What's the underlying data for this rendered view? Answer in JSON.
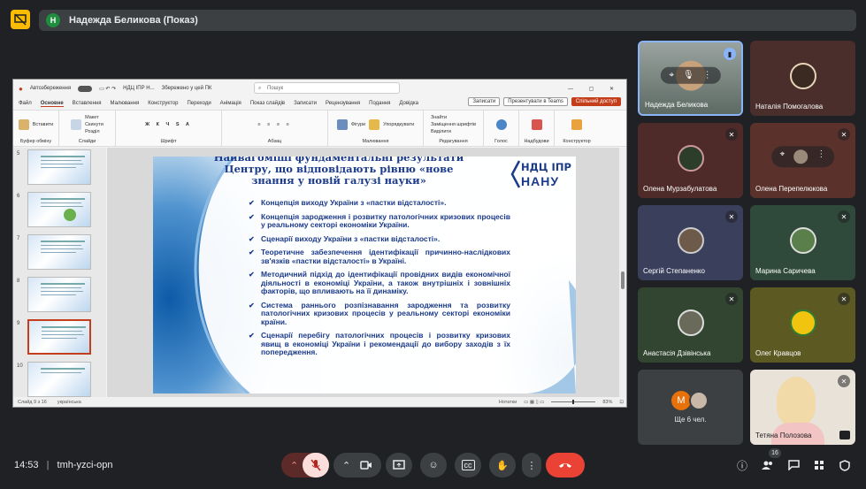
{
  "meeting": {
    "presenter_initial": "Н",
    "presenter_label": "Надежда Беликова (Показ)",
    "time": "14:53",
    "code": "tmh-yzci-opn",
    "participant_count": "16"
  },
  "ppt": {
    "autosave": "Автозбереження",
    "file": "НДЦ ІПР Н...",
    "saved": "Збережено у цей ПК",
    "search": "Пошук",
    "menu": [
      "Файл",
      "Основне",
      "Вставлення",
      "Малювання",
      "Конструктор",
      "Переходи",
      "Анімація",
      "Показ слайдів",
      "Записати",
      "Рецензування",
      "Подання",
      "Довідка"
    ],
    "record_btn": "Записати",
    "present_teams": "Презентувати в Teams",
    "share_btn": "Спільний доступ",
    "ribbon_groups": [
      "Буфер обміну",
      "Слайди",
      "Шрифт",
      "Абзац",
      "Малювання",
      "Редагування",
      "Голос",
      "Надбудови"
    ],
    "ribbon_labels": {
      "paste": "Вставити",
      "new_slide": "Створити слайд",
      "layout": "Макет",
      "reset": "Скинути",
      "section": "Розділ",
      "shapes": "Фігури",
      "arrange": "Упорядкувати",
      "quick_styles": "Експрес-стилі",
      "find": "Знайти",
      "replace": "Замінити",
      "replace_fonts": "Заміщення шрифтів",
      "select": "Виділити",
      "dictate": "Надиктувати",
      "addins": "Надбудови",
      "designer": "Конструктор"
    },
    "thumb_numbers": [
      "5",
      "6",
      "7",
      "8",
      "9",
      "10"
    ],
    "status_left": "Слайд 9 з 16",
    "status_lang": "українська",
    "status_notes": "Нотатки",
    "zoom": "83%"
  },
  "slide": {
    "title": "Найвагоміші фундаментальні результати Центру, що відповідають рівню «нове знання у новій галузі науки»",
    "logo_top": "НДЦ ІПР",
    "logo_bottom": "НАНУ",
    "bullets": [
      "Концепція виходу України з «пастки відсталості».",
      "Концепція зародження і розвитку патологічних кризових процесів у реальному секторі економіки України.",
      "Сценарії виходу України з «пастки відсталості».",
      "Теоретичне забезпечення ідентифікації причинно-наслідкових зв'язків «пастки відсталості» в Україні.",
      "Методичний підхід до ідентифікації провідних видів економічної діяльності в економіці України, а також внутрішніх і зовнішніх факторів, що впливають на її динаміку.",
      "Система раннього розпізнавання зародження та розвитку патологічних кризових процесів у реальному секторі економіки країни.",
      "Сценарії перебігу патологічних процесів і розвитку кризових явищ в економіці України і рекомендації до вибору заходів з їх попередження."
    ]
  },
  "participants": [
    {
      "name": "Надежда Беликова"
    },
    {
      "name": "Наталія Помогалова"
    },
    {
      "name": "Олена Мурзабулатова"
    },
    {
      "name": "Олена Перепелюкова"
    },
    {
      "name": "Сергій Степаненко"
    },
    {
      "name": "Марина Саричева"
    },
    {
      "name": "Анастасія Дзівінська"
    },
    {
      "name": "Олег Кравцов"
    },
    {
      "name": "Ще 6 чел.",
      "initial": "М"
    },
    {
      "name": "Тетяна Полозова"
    }
  ],
  "colors": {
    "meet_bg": "#202124",
    "accent_red": "#ea4335",
    "ppt_accent": "#c43e1c",
    "slide_text": "#1b3a8a"
  }
}
